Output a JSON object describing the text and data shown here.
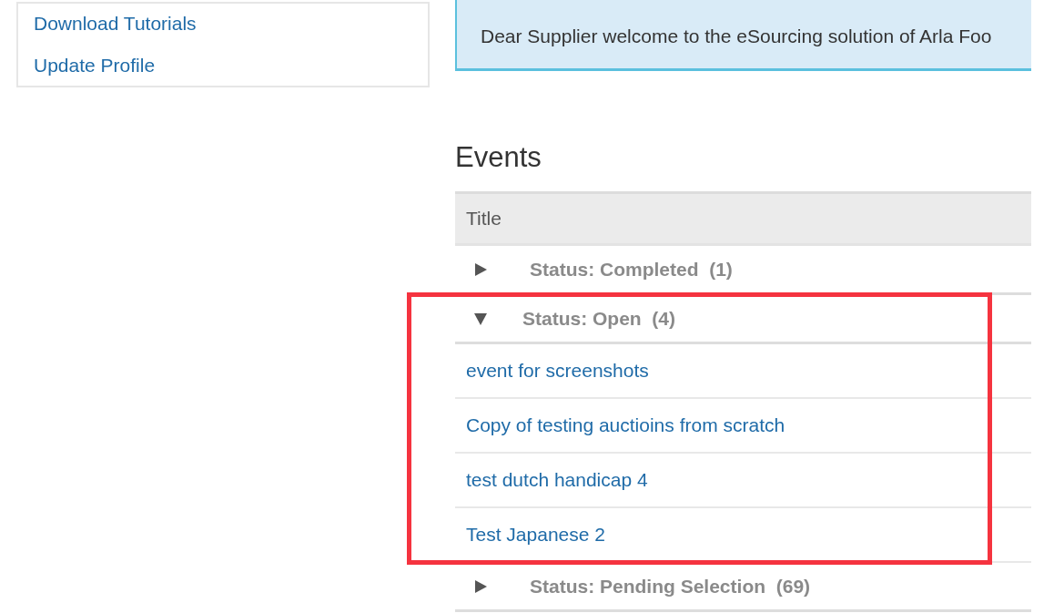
{
  "sidebar": {
    "links": [
      "Download Tutorials",
      "Update Profile"
    ]
  },
  "notice": {
    "text": "Dear Supplier welcome to the eSourcing solution of Arla Foo"
  },
  "events": {
    "heading": "Events",
    "columns": [
      "Title"
    ],
    "groups": [
      {
        "label": "Status: Completed  (1)",
        "expanded": false,
        "highlighted": false
      },
      {
        "label": "Status: Open  (4)",
        "expanded": true,
        "highlighted": true,
        "rows": [
          "event for screenshots",
          "Copy of testing auctioins from scratch",
          "test dutch handicap 4",
          "Test Japanese 2"
        ]
      },
      {
        "label": "Status: Pending Selection  (69)",
        "expanded": false,
        "highlighted": false
      }
    ]
  }
}
